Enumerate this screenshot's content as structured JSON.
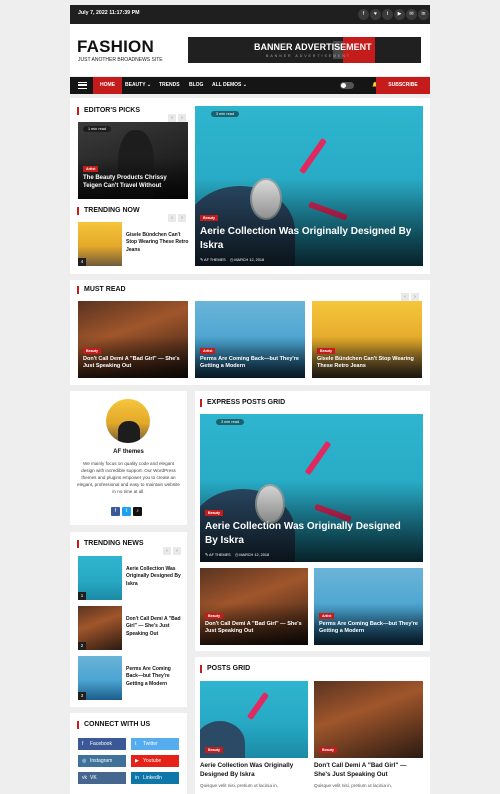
{
  "topbar": {
    "date": "July 7, 2022  11:17:39 PM",
    "social_icons": [
      "f",
      "♥",
      "t",
      "▶",
      "✉",
      "in"
    ]
  },
  "header": {
    "logo": "FASHION",
    "tagline": "JUST ANOTHER BROADNEWS SITE",
    "banner_title": "BANNER ADVERTISEMENT",
    "banner_sub": "BANNER ADVERTISEMENT"
  },
  "nav": {
    "items": [
      "HOME",
      "BEAUTY ⌄",
      "TRENDS",
      "BLOG",
      "ALL DEMOS ⌄"
    ],
    "subscribe": "SUBSCRIBE",
    "subscribe_icon": "🔔"
  },
  "editors_picks": {
    "title": "EDITOR'S PICKS",
    "card_pill": "1 min read",
    "card_tag": "Artist",
    "card_title": "The Beauty Products Chrissy Teigen Can't Travel Without",
    "feature_pill": "3 min read",
    "feature_tag": "Beauty",
    "feature_title": "Aerie Collection Was Originally Designed By Iskra",
    "feature_author": "AF THEMES",
    "feature_date": "MARCH 12, 2018"
  },
  "trending_now": {
    "title": "TRENDING NOW",
    "item_num": "4",
    "item_title": "Gisele Bündchen Can't Stop Wearing These Retro Jeans"
  },
  "must_read": {
    "title": "MUST READ",
    "items": [
      {
        "tag": "Beauty",
        "title": "Don't Call Demi A \"Bad Girl\" — She's Just Speaking Out"
      },
      {
        "tag": "Artist",
        "title": "Perms Are Coming Back—but They're Getting a Modern"
      },
      {
        "tag": "Beauty",
        "title": "Gisele Bündchen Can't Stop Wearing These Retro Jeans"
      }
    ]
  },
  "profile": {
    "name": "AF themes",
    "text": "We mainly focus on quality code and elegant design with incredible support. Our WordPress themes and plugins empower you to create an elegant, professional and easy to maintain website in no time at all.",
    "icons": [
      "f",
      "t",
      "♪"
    ]
  },
  "express": {
    "title": "EXPRESS POSTS GRID",
    "feature_pill": "3 min read",
    "feature_tag": "Beauty",
    "feature_title": "Aerie Collection Was Originally Designed By Iskra",
    "feature_author": "AF THEMES",
    "feature_date": "MARCH 12, 2018",
    "small": [
      {
        "tag": "Beauty",
        "title": "Don't Call Demi A \"Bad Girl\" — She's Just Speaking Out"
      },
      {
        "tag": "Artist",
        "title": "Perms Are Coming Back—but They're Getting a Modern"
      }
    ]
  },
  "trending_news": {
    "title": "TRENDING NEWS",
    "items": [
      {
        "num": "1",
        "title": "Aerie Collection Was Originally Designed By Iskra"
      },
      {
        "num": "2",
        "title": "Don't Call Demi A \"Bad Girl\" — She's Just Speaking Out"
      },
      {
        "num": "3",
        "title": "Perms Are Coming Back—but They're Getting a Modern"
      }
    ]
  },
  "posts_grid": {
    "title": "POSTS GRID",
    "items": [
      {
        "tag": "Beauty",
        "title": "Aerie Collection Was Originally Designed By Iskra",
        "excerpt": "Quisque velit nisi, pretium ut lacinia in,"
      },
      {
        "tag": "Beauty",
        "title": "Don't Call Demi A \"Bad Girl\" — She's Just Speaking Out",
        "excerpt": "Quisque velit nisi, pretium ut lacinia in,"
      }
    ]
  },
  "connect": {
    "title": "CONNECT WITH US",
    "buttons": [
      {
        "label": "Facebook",
        "icon": "f",
        "color": "#3b5998"
      },
      {
        "label": "Twitter",
        "icon": "t",
        "color": "#55acee"
      },
      {
        "label": "Instagram",
        "icon": "◎",
        "color": "#3f729b"
      },
      {
        "label": "Youtube",
        "icon": "▶",
        "color": "#e62117"
      },
      {
        "label": "VK",
        "icon": "vk",
        "color": "#45668e"
      },
      {
        "label": "LinkedIn",
        "icon": "in",
        "color": "#0e76a8"
      }
    ]
  },
  "colors": {
    "accent": "#c41b1b",
    "dark": "#151515"
  }
}
